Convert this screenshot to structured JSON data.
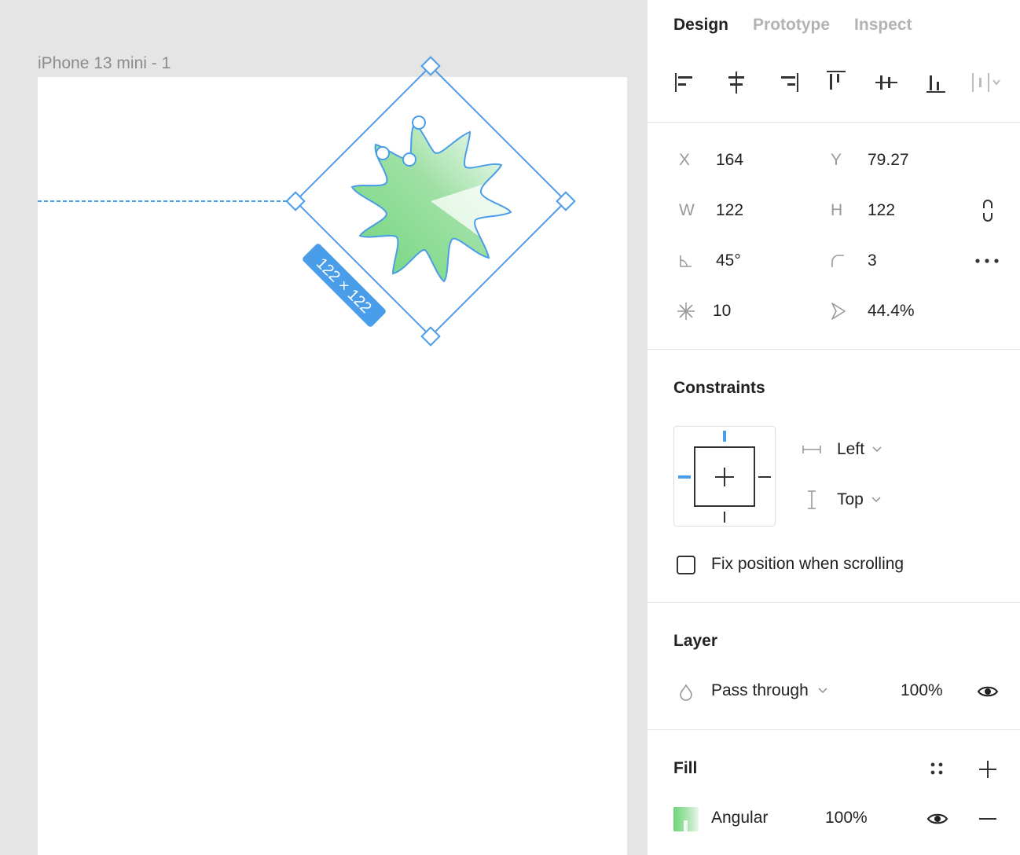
{
  "canvas": {
    "frame_label": "iPhone 13 mini - 1",
    "size_badge": "122 × 122",
    "colors": {
      "selection": "#4a9de8",
      "gradient_start": "#6fd57a",
      "gradient_end": "#ffffff"
    }
  },
  "tabs": [
    {
      "label": "Design",
      "active": true
    },
    {
      "label": "Prototype",
      "active": false
    },
    {
      "label": "Inspect",
      "active": false
    }
  ],
  "align_icons": [
    "align-left-icon",
    "align-horizontal-center-icon",
    "align-right-icon",
    "align-top-icon",
    "align-vertical-center-icon",
    "align-bottom-icon",
    "distribute-icon"
  ],
  "props": {
    "x": {
      "label": "X",
      "value": "164"
    },
    "y": {
      "label": "Y",
      "value": "79.27"
    },
    "w": {
      "label": "W",
      "value": "122"
    },
    "h": {
      "label": "H",
      "value": "122"
    },
    "rotation": "45°",
    "corner_radius": "3",
    "points": "10",
    "ratio": "44.4%"
  },
  "constraints": {
    "title": "Constraints",
    "horizontal": "Left",
    "vertical": "Top",
    "fix_position_label": "Fix position when scrolling",
    "fix_position_checked": false
  },
  "layer": {
    "title": "Layer",
    "blend_mode": "Pass through",
    "opacity": "100%"
  },
  "fill": {
    "title": "Fill",
    "type": "Angular",
    "opacity": "100%"
  }
}
